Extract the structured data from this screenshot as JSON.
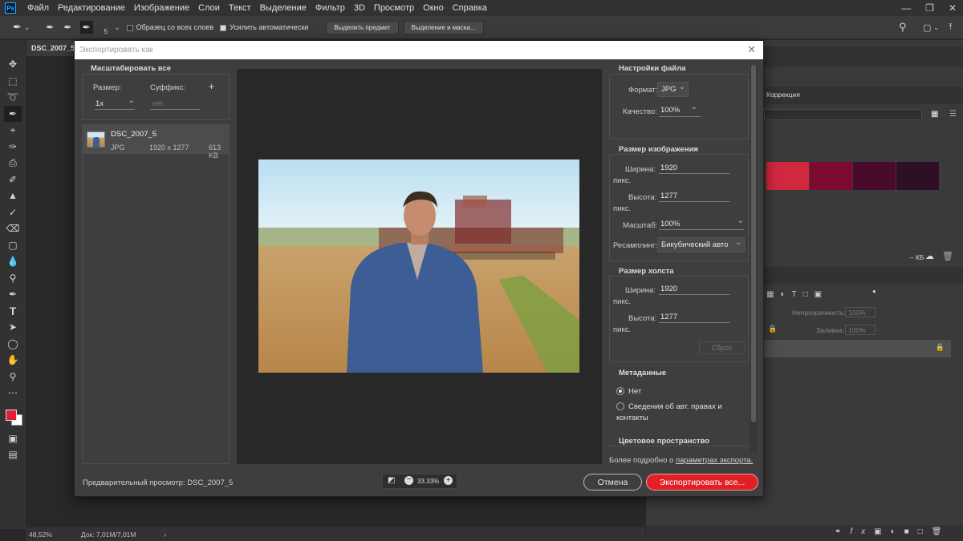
{
  "menubar": {
    "app_icon": "Ps",
    "items": [
      "Файл",
      "Редактирование",
      "Изображение",
      "Слои",
      "Текст",
      "Выделение",
      "Фильтр",
      "3D",
      "Просмотр",
      "Окно",
      "Справка"
    ]
  },
  "options": {
    "brush_size": "5",
    "sample_all_layers": "Образец со всех слоев",
    "auto_enhance": "Усилить автоматически",
    "select_subject": "Выделить предмет",
    "select_mask": "Выделение и маска..."
  },
  "document": {
    "tab_title": "DSC_2007_5."
  },
  "status": {
    "zoom": "48,52%",
    "doc_info": "Док: 7,01M/7,01M"
  },
  "right_panel": {
    "correction_tab": "Коррекция",
    "kb_label": "-- КБ",
    "opacity_label": "Непрозрачность:",
    "opacity_value": "100%",
    "fill_label": "Заливка:",
    "fill_value": "100%"
  },
  "swatches": [
    "#d1283f",
    "#7f0a30",
    "#4a0a2c",
    "#2e0f26"
  ],
  "dialog": {
    "title": "Экспортировать как",
    "scale_all": {
      "title": "Масштабировать все",
      "size_label": "Размер:",
      "suffix_label": "Суффикс:",
      "size_value": "1x",
      "suffix_placeholder": "нет"
    },
    "asset": {
      "name": "DSC_2007_5",
      "format": "JPG",
      "dimensions": "1920 x 1277",
      "filesize": "613 KB"
    },
    "file_settings": {
      "title": "Настройки файла",
      "format_label": "Формат:",
      "format_value": "JPG",
      "quality_label": "Качество:",
      "quality_value": "100%"
    },
    "image_size": {
      "title": "Размер изображения",
      "width_label": "Ширина:",
      "width_value": "1920",
      "height_label": "Высота:",
      "height_value": "1277",
      "unit": "пикс.",
      "scale_label": "Масштаб:",
      "scale_value": "100%",
      "resample_label": "Ресамплинг:",
      "resample_value": "Бикубический авто"
    },
    "canvas_size": {
      "title": "Размер холста",
      "width_label": "Ширина:",
      "width_value": "1920",
      "height_label": "Высота:",
      "height_value": "1277",
      "unit": "пикс.",
      "reset": "Сброс"
    },
    "metadata": {
      "title": "Метаданные",
      "option_none": "Нет",
      "option_copyright": "Сведения об авт. правах и контакты"
    },
    "color_space": {
      "title": "Цветовое пространство"
    },
    "learn_more": "Более подробно о",
    "learn_more_link": "параметрах экспорта.",
    "preview_label": "Предварительный просмотр: DSC_2007_5",
    "zoom_value": "33.33%",
    "cancel": "Отмена",
    "export": "Экспортировать все..."
  }
}
